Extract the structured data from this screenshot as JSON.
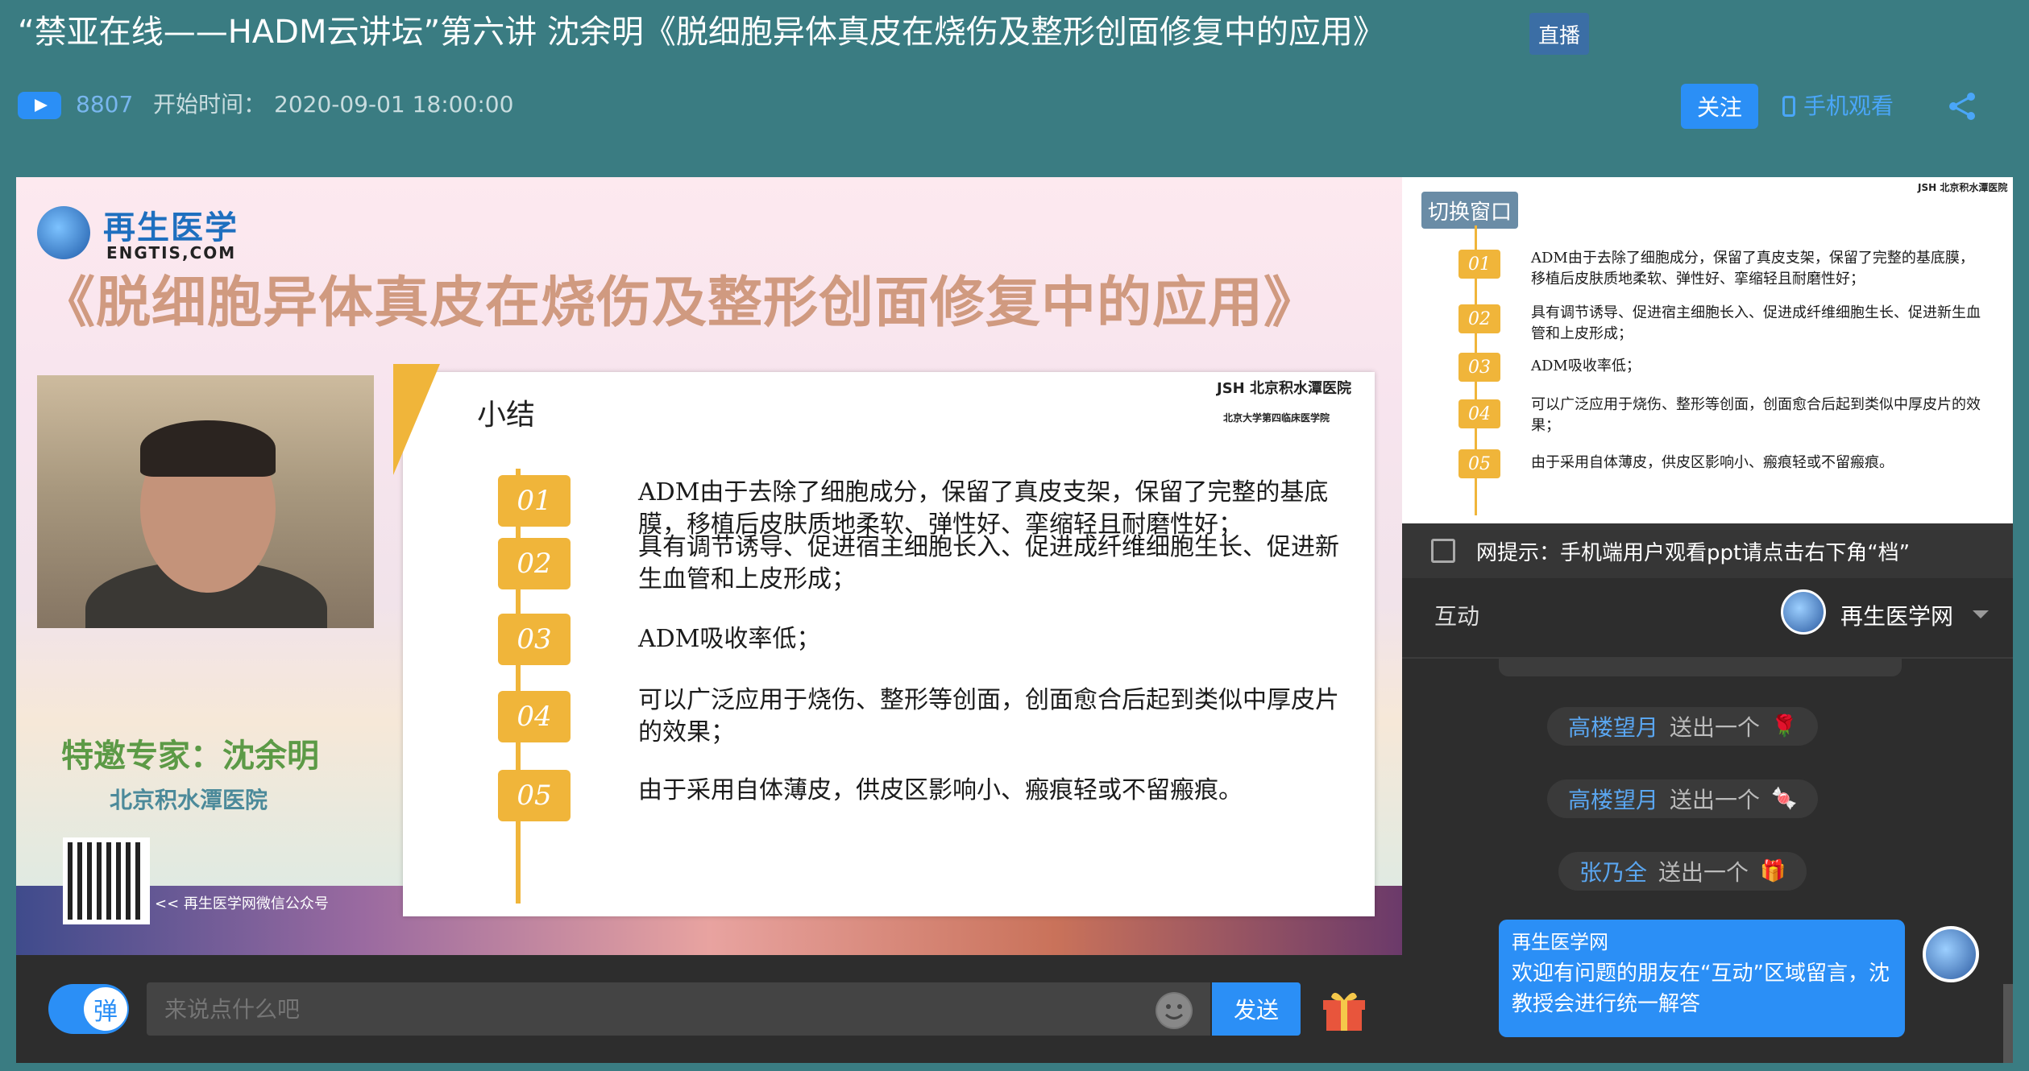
{
  "header": {
    "title": "“禁亚在线——HADM云讲坛”第六讲 沈余明《脱细胞异体真皮在烧伤及整形创面修复中的应用》",
    "live_badge": "直播",
    "view_count": "8807",
    "start_label": "开始时间：",
    "start_time": "2020-09-01 18:00:00",
    "follow_label": "关注",
    "mobile_watch_label": "手机观看"
  },
  "video": {
    "brand_name": "再生医学",
    "brand_url": "ENGTIS,COM",
    "title": "《脱细胞异体真皮在烧伤及整形创面修复中的应用》",
    "expert_label": "特邀专家：沈余明",
    "expert_hospital": "北京积水潭医院",
    "qr_caption": "<< 再生医学网微信公众号"
  },
  "slide": {
    "heading": "小结",
    "logo": "JSH 北京积水潭医院",
    "logo_sub": "北京大学第四临床医学院",
    "items": [
      {
        "num": "01",
        "text": "ADM由于去除了细胞成分，保留了真皮支架，保留了完整的基底膜，移植后皮肤质地柔软、弹性好、挛缩轻且耐磨性好；"
      },
      {
        "num": "02",
        "text": "具有调节诱导、促进宿主细胞长入、促进成纤维细胞生长、促进新生血管和上皮形成；"
      },
      {
        "num": "03",
        "text": "ADM吸收率低；"
      },
      {
        "num": "04",
        "text": "可以广泛应用于烧伤、整形等创面，创面愈合后起到类似中厚皮片的效果；"
      },
      {
        "num": "05",
        "text": "由于采用自体薄皮，供皮区影响小、瘢痕轻或不留瘢痕。"
      }
    ]
  },
  "bottom_bar": {
    "danmu_label": "弹",
    "comment_placeholder": "来说点什么吧",
    "send_label": "发送"
  },
  "right_panel": {
    "switch_window_label": "切换窗口",
    "mini_logo": "JSH 北京积水潭医院",
    "tip_text": "网提示：手机端用户观看ppt请点击右下角“档”",
    "interaction_tab": "互动",
    "host_name": "再生医学网",
    "gift_messages": [
      {
        "user": "高楼望月",
        "verb": "送出一个",
        "gift": "🌹"
      },
      {
        "user": "高楼望月",
        "verb": "送出一个",
        "gift": "🍬"
      },
      {
        "user": "张乃全",
        "verb": "送出一个",
        "gift": "🎁"
      }
    ],
    "host_message": {
      "name": "再生医学网",
      "text": "欢迎有问题的朋友在“互动”区域留言，沈教授会进行统一解答"
    }
  }
}
